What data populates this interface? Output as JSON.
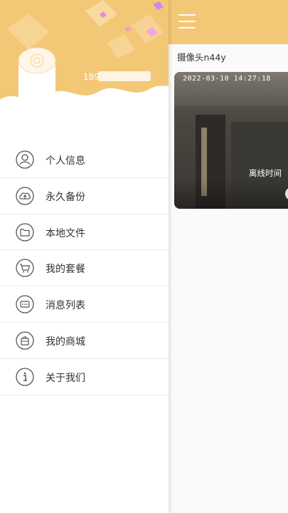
{
  "main": {
    "camera_name": "摄像头n44y",
    "camera_timestamp": "2022-03-10  14:27:18",
    "camera_status": "离线时间"
  },
  "drawer": {
    "phone": "189",
    "menu": [
      {
        "label": "个人信息",
        "icon": "person-icon"
      },
      {
        "label": "永久备份",
        "icon": "cloud-upload-icon"
      },
      {
        "label": "本地文件",
        "icon": "folder-icon"
      },
      {
        "label": "我的套餐",
        "icon": "cart-icon"
      },
      {
        "label": "消息列表",
        "icon": "message-icon"
      },
      {
        "label": "我的商城",
        "icon": "shop-icon"
      },
      {
        "label": "关于我们",
        "icon": "info-icon"
      }
    ]
  },
  "colors": {
    "header_yellow": "#f2c877",
    "icon_stroke": "#555555",
    "text": "#333333"
  }
}
